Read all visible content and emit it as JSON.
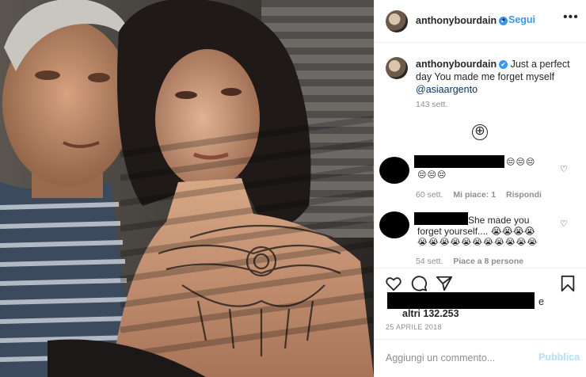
{
  "post": {
    "photo_alt": "photo",
    "username": "anthonybourdain",
    "verified_mark": "✔",
    "follow_label": "Segui",
    "dot_separator": "•",
    "more_icon": "•••"
  },
  "caption": {
    "username": "anthonybourdain",
    "text": "Just a perfect day You made me forget myself",
    "mention": "@asiaargento",
    "time": "143 sett."
  },
  "load_more_icon": "⊕",
  "comments": [
    {
      "text_after_redaction": "😔😔😔",
      "text_line2": "😔😔😔",
      "time": "60 sett.",
      "likes": "Mi piace: 1",
      "reply": "Rispondi"
    },
    {
      "text_after_redaction": "She made you",
      "text_line2": "forget yourself.... 😭😭😭😭",
      "text_line3": "😭😭😭😭😭😭😭😭😭😭😭",
      "time": "54 sett.",
      "likes": "Piace a 8 persone"
    }
  ],
  "heart_icon": "♡",
  "likes": {
    "and": "e",
    "others": "altri 132.253"
  },
  "date": "25 APRILE 2018",
  "add_comment": {
    "placeholder": "Aggiungi un commento...",
    "publish": "Pubblica"
  },
  "colors": {
    "link_blue": "#3897f0",
    "mention_blue": "#00376b",
    "publish_disabled": "#b2dffc",
    "muted_gray": "#8e8e8e"
  }
}
